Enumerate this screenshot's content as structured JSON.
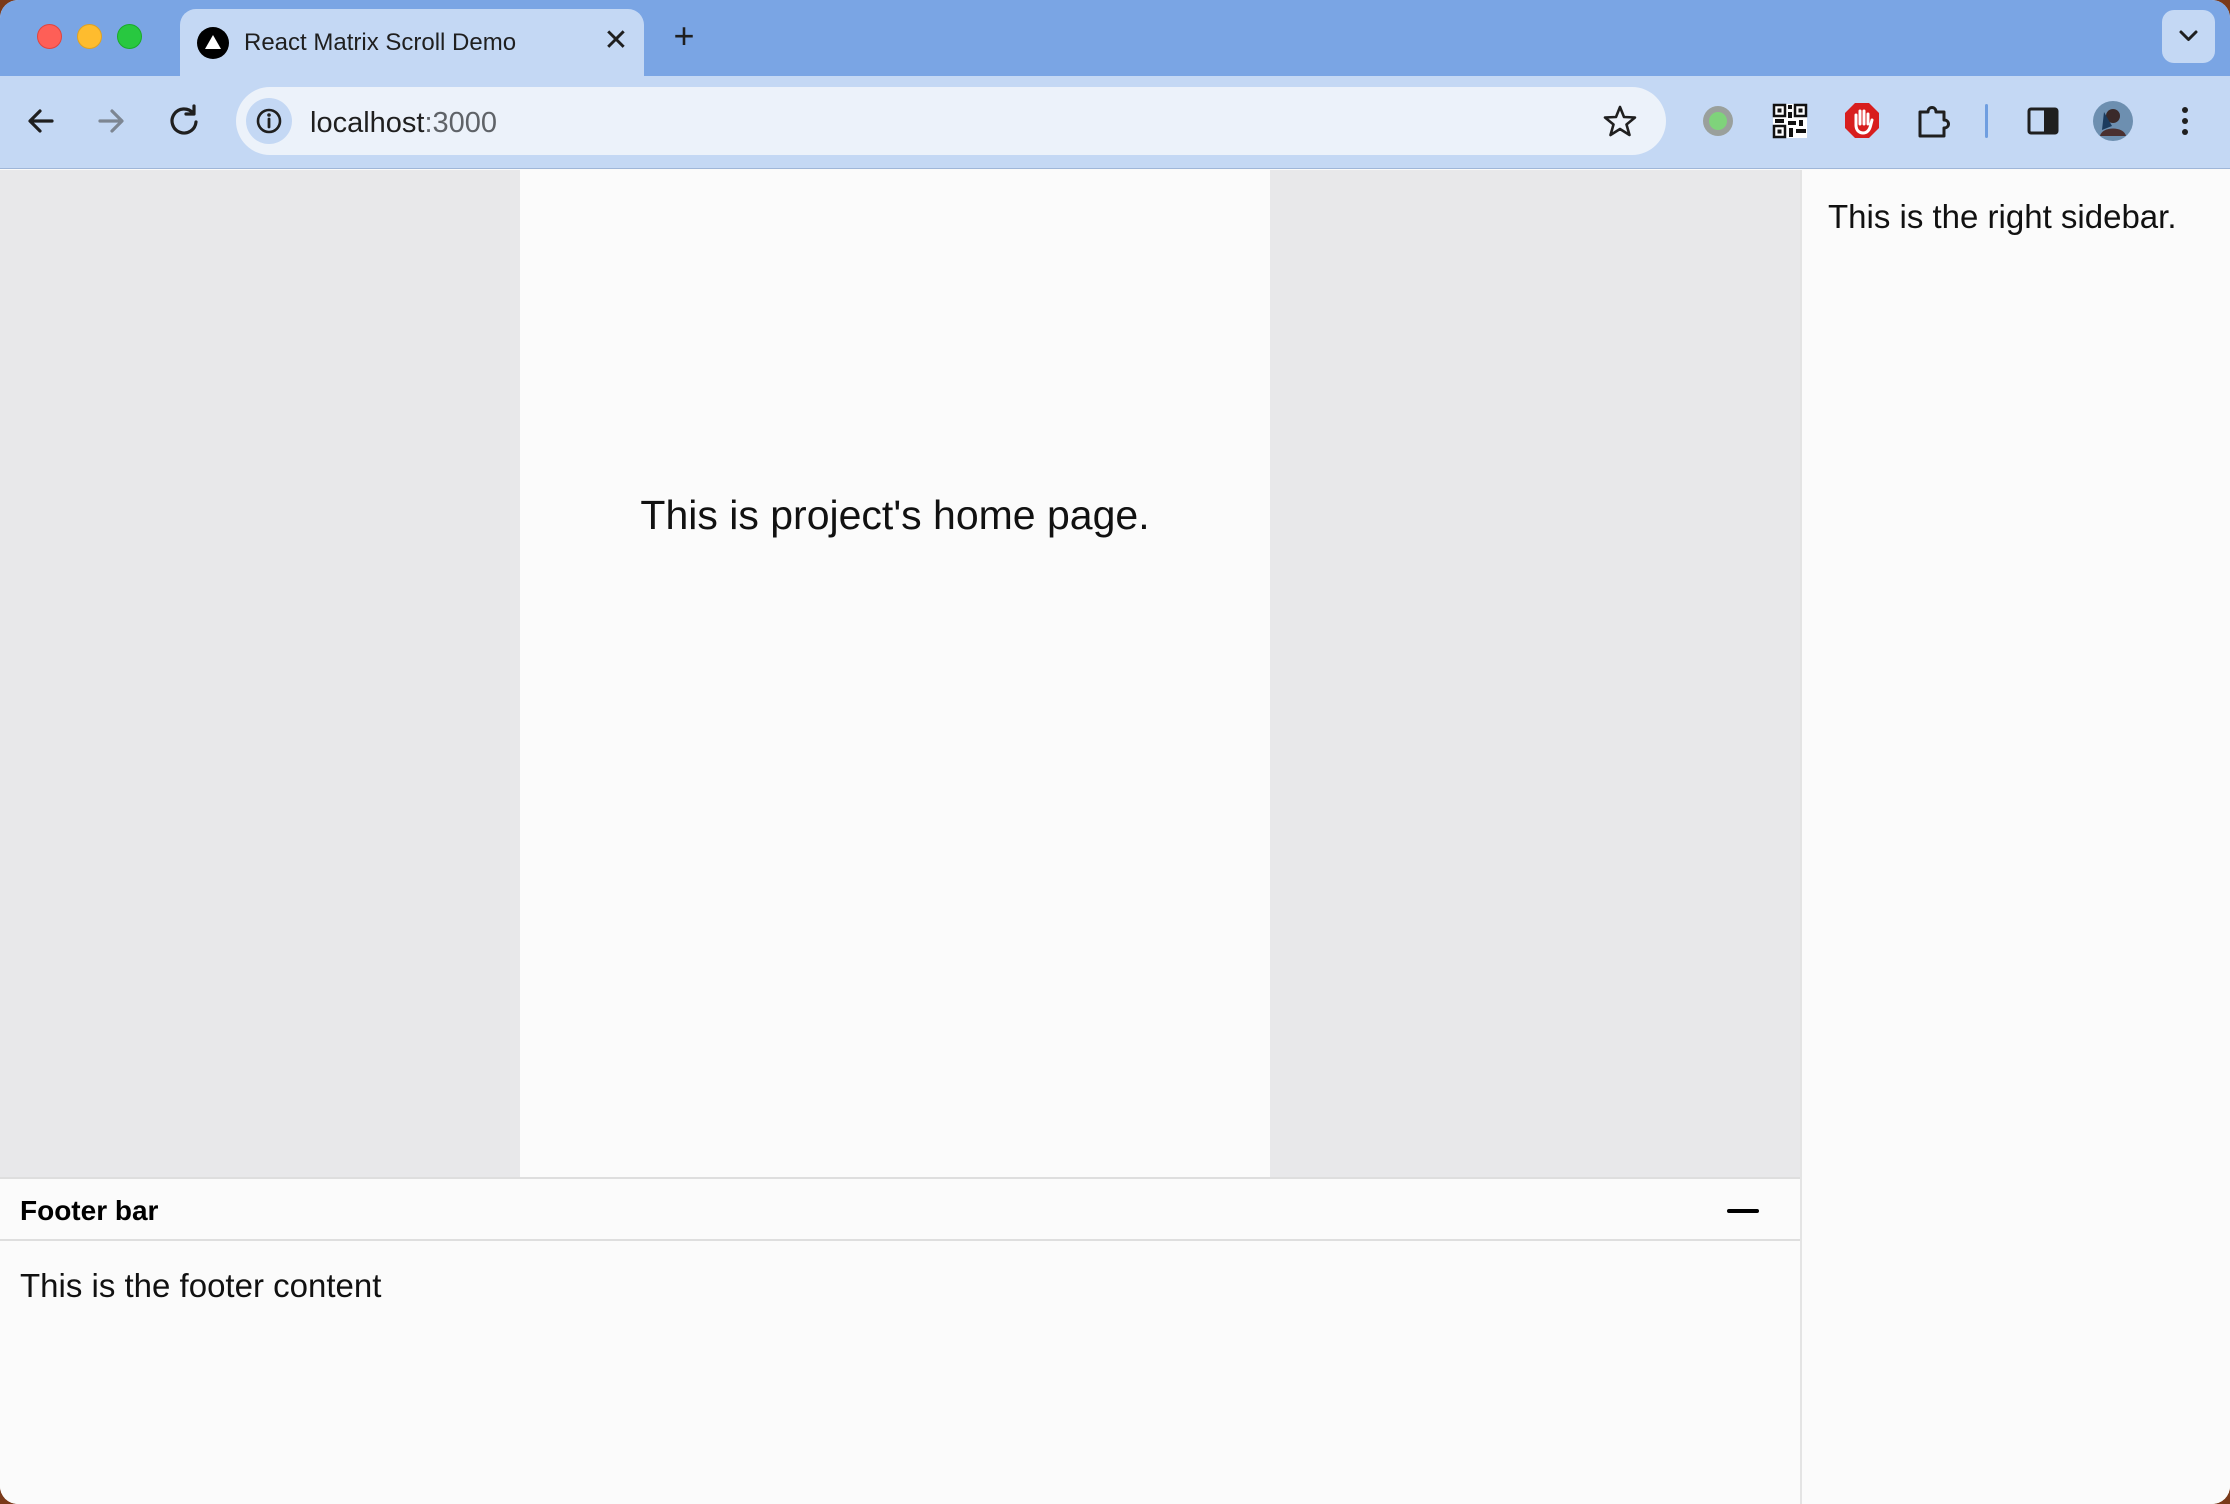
{
  "browser": {
    "tab": {
      "title": "React Matrix Scroll Demo",
      "close_glyph": "✕"
    },
    "new_tab_glyph": "+",
    "address": {
      "host": "localhost",
      "port": ":3000"
    },
    "icons": {
      "favicon": "triangle-logo-icon",
      "back": "back-arrow-icon",
      "forward": "forward-arrow-icon",
      "reload": "reload-icon",
      "site_info": "info-icon",
      "bookmark": "star-icon",
      "extensions": [
        "green-dot-extension-icon",
        "qr-code-icon",
        "stop-hand-icon",
        "puzzle-extensions-icon"
      ],
      "side_panel": "side-panel-icon",
      "avatar": "profile-avatar-icon",
      "menu": "kebab-menu-icon",
      "tab_search": "chevron-down-icon"
    },
    "colors": {
      "tabstrip": "#7aa5e4",
      "toolbar": "#c4d8f4",
      "omnibox": "#ecf2fa"
    }
  },
  "main": {
    "home_text": "This is project's home page."
  },
  "sidebar": {
    "text": "This is the right sidebar."
  },
  "footer": {
    "title": "Footer bar",
    "content": "This is the footer content"
  }
}
